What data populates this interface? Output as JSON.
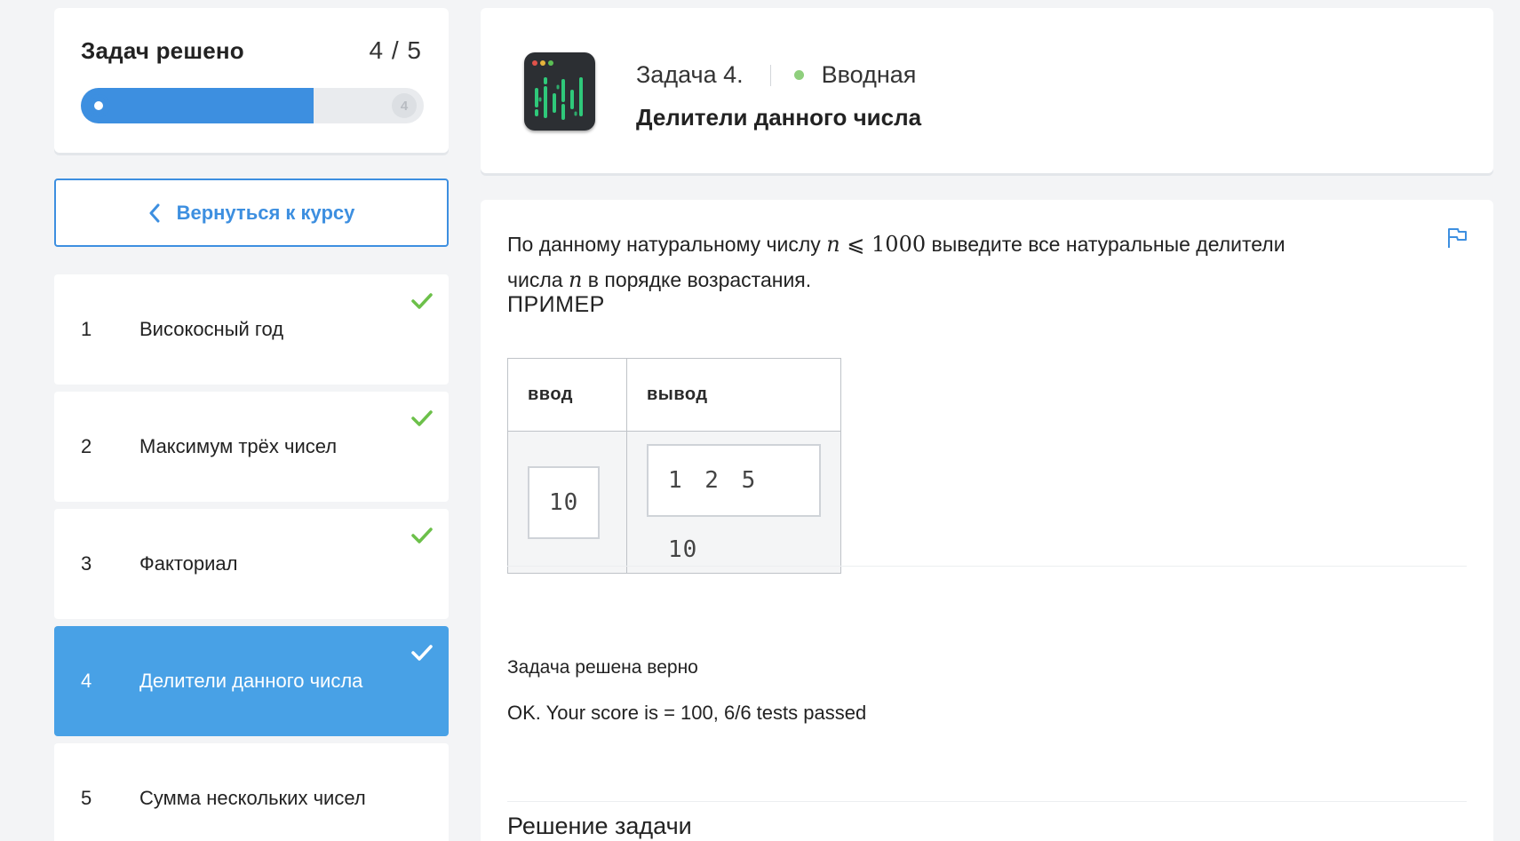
{
  "progress": {
    "title": "Задач решено",
    "count": "4 / 5",
    "fraction": 0.8,
    "end_marker": "4"
  },
  "back_button": {
    "label": "Вернуться к курсу",
    "icon": "chevron-left-icon"
  },
  "tasks": [
    {
      "num": "1",
      "title": "Високосный год",
      "solved": true,
      "active": false
    },
    {
      "num": "2",
      "title": "Максимум трёх чисел",
      "solved": true,
      "active": false
    },
    {
      "num": "3",
      "title": "Факториал",
      "solved": true,
      "active": false
    },
    {
      "num": "4",
      "title": "Делители данного числа",
      "solved": true,
      "active": true
    },
    {
      "num": "5",
      "title": "Сумма нескольких чисел",
      "solved": false,
      "active": false
    }
  ],
  "header": {
    "task_label": "Задача 4.",
    "category": "Вводная",
    "title": "Делители данного числа",
    "category_color": "#8fcf7d"
  },
  "statement": {
    "part1": "По данному натуральному числу ",
    "var_n": "n",
    "relation": " ⩽ 1000",
    "part2": " выведите все натуральные делители",
    "part3": "числа ",
    "part4": " в порядке возрастания."
  },
  "example": {
    "label": "ПРИМЕР",
    "col_input": "ввод",
    "col_output": "вывод",
    "input": "10",
    "output": "1 2 5 10"
  },
  "result": {
    "title": "Задача решена верно",
    "message": "OK. Your score is = 100, 6/6 tests passed"
  },
  "solution_title": "Решение задачи",
  "colors": {
    "accent": "#3d8fe0",
    "active_item": "#48a1e6",
    "check": "#6cc04a"
  }
}
